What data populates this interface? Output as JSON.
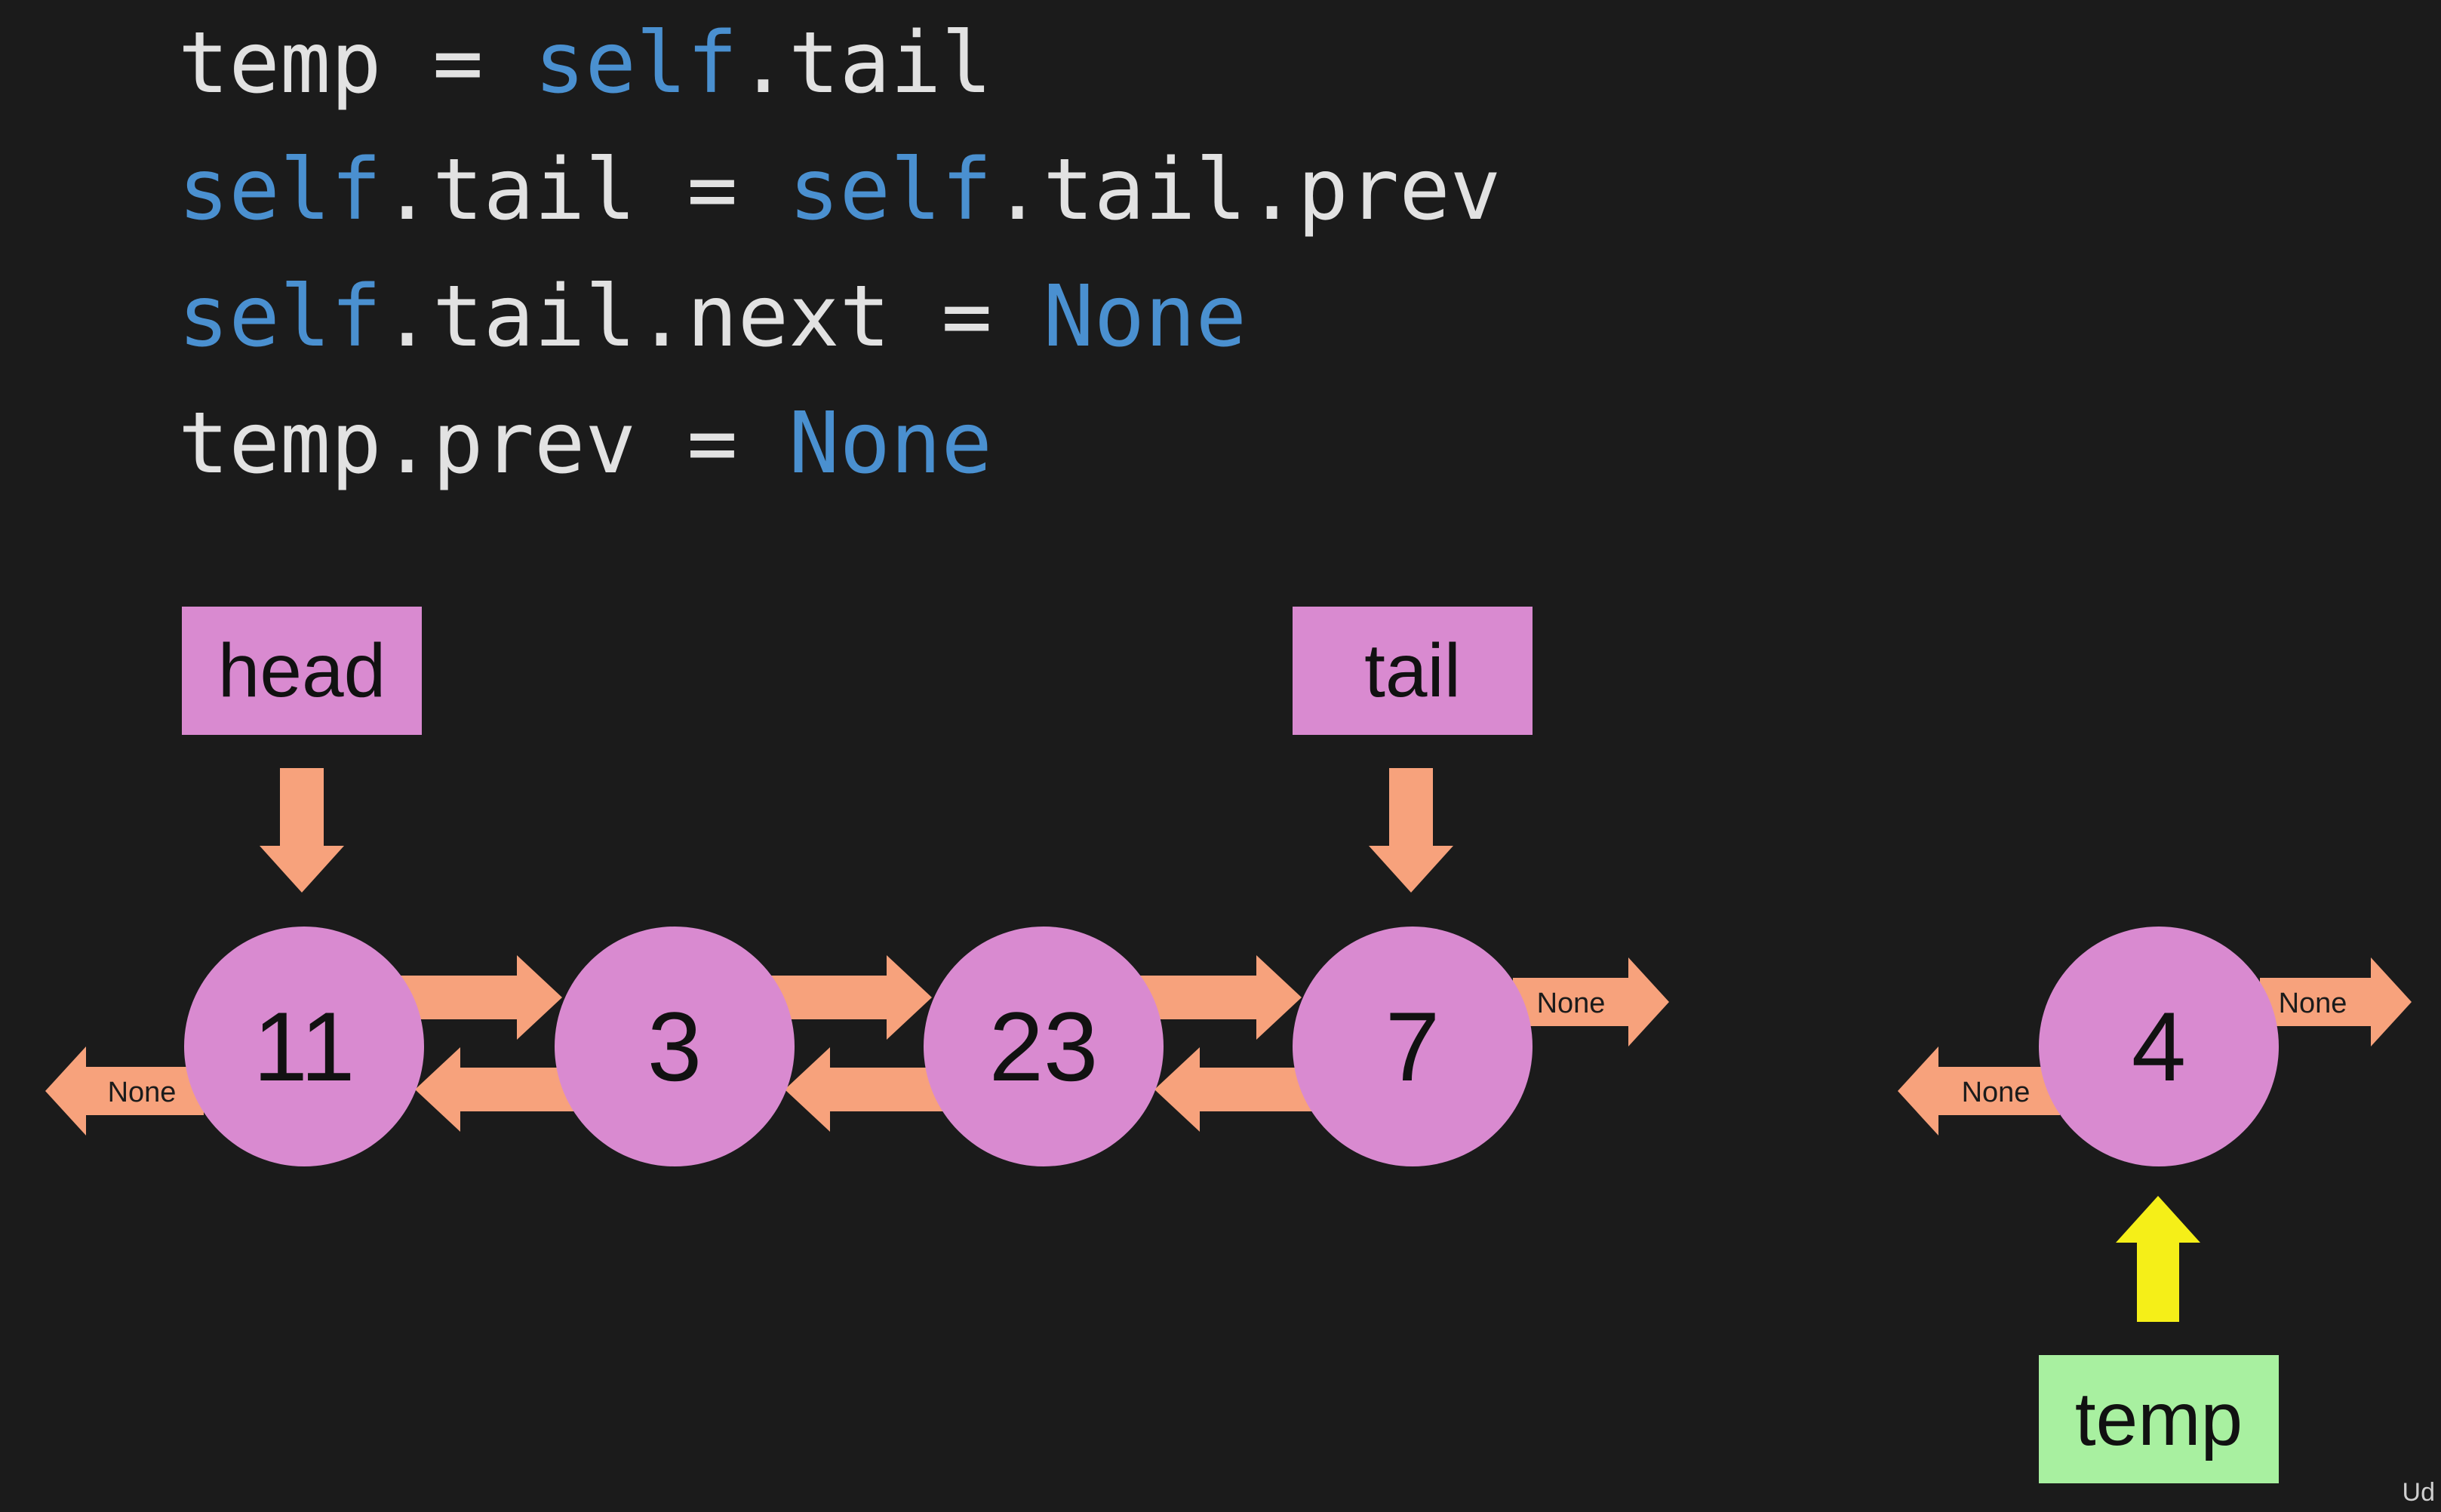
{
  "code": {
    "lines": [
      [
        {
          "text": "temp = ",
          "kw": false
        },
        {
          "text": "self",
          "kw": true
        },
        {
          "text": ".tail",
          "kw": false
        }
      ],
      [
        {
          "text": "self",
          "kw": true
        },
        {
          "text": ".tail = ",
          "kw": false
        },
        {
          "text": "self",
          "kw": true
        },
        {
          "text": ".tail.prev",
          "kw": false
        }
      ],
      [
        {
          "text": "self",
          "kw": true
        },
        {
          "text": ".tail.next = ",
          "kw": false
        },
        {
          "text": "None",
          "kw": true
        }
      ],
      [
        {
          "text": "temp.prev = ",
          "kw": false
        },
        {
          "text": "None",
          "kw": true
        }
      ]
    ]
  },
  "labels": {
    "head": "head",
    "tail": "tail",
    "temp": "temp"
  },
  "list_nodes": [
    "11",
    "3",
    "23",
    "7"
  ],
  "detached_node": "4",
  "none_text": "None",
  "watermark": "Ud",
  "colors": {
    "background": "#1b1b1b",
    "code_text": "#e2e2e2",
    "keyword": "#4a90d0",
    "node_fill": "#d98ad0",
    "label_fill": "#d98ad0",
    "temp_fill": "#a8f0a0",
    "arrow": "#f7a27c",
    "temp_arrow": "#f5ef18"
  }
}
